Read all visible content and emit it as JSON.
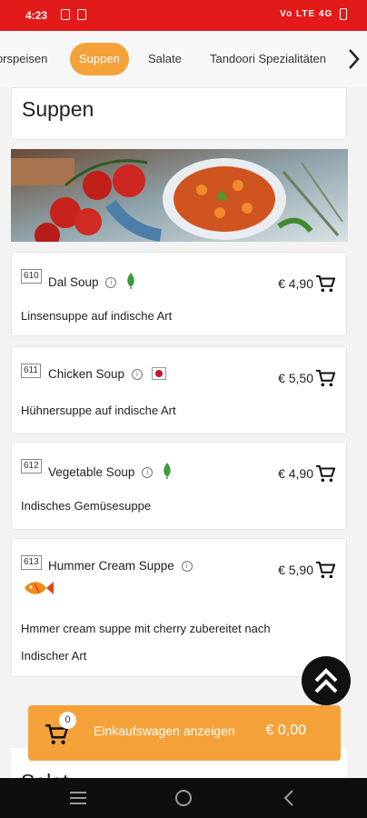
{
  "status": {
    "time": "4:23",
    "right_text": "Vo LTE 4G"
  },
  "tabs": [
    {
      "label": "Vorspeisen"
    },
    {
      "label": "Suppen",
      "active": true
    },
    {
      "label": "Salate"
    },
    {
      "label": "Tandoori Spezialitäten"
    }
  ],
  "section": {
    "title": "Suppen"
  },
  "items": [
    {
      "number": "610",
      "name": "Dal Soup",
      "price": "€ 4,90",
      "description": "Linsensuppe auf indische Art",
      "badge": "leaf-icon"
    },
    {
      "number": "611",
      "name": "Chicken Soup",
      "price": "€ 5,50",
      "description": "Hühnersuppe auf indische Art",
      "badge": "chicken-icon"
    },
    {
      "number": "612",
      "name": "Vegetable Soup",
      "price": "€ 4,90",
      "description": "Indisches Gemüsesuppe",
      "badge": "leaf-icon"
    },
    {
      "number": "613",
      "name": "Hummer Cream Suppe",
      "price": "€ 5,90",
      "description": "Hmmer cream suppe mit cherry zubereitet nach Indischer Art",
      "badge": "fish-icon"
    }
  ],
  "cart": {
    "count": "0",
    "label": "Einkaufswagen anzeigen",
    "total": "€ 0,00"
  },
  "next_section": {
    "title": "Salat"
  },
  "colors": {
    "status_bar": "#e31a1a",
    "accent": "#f5a23a",
    "fab": "#111111"
  }
}
